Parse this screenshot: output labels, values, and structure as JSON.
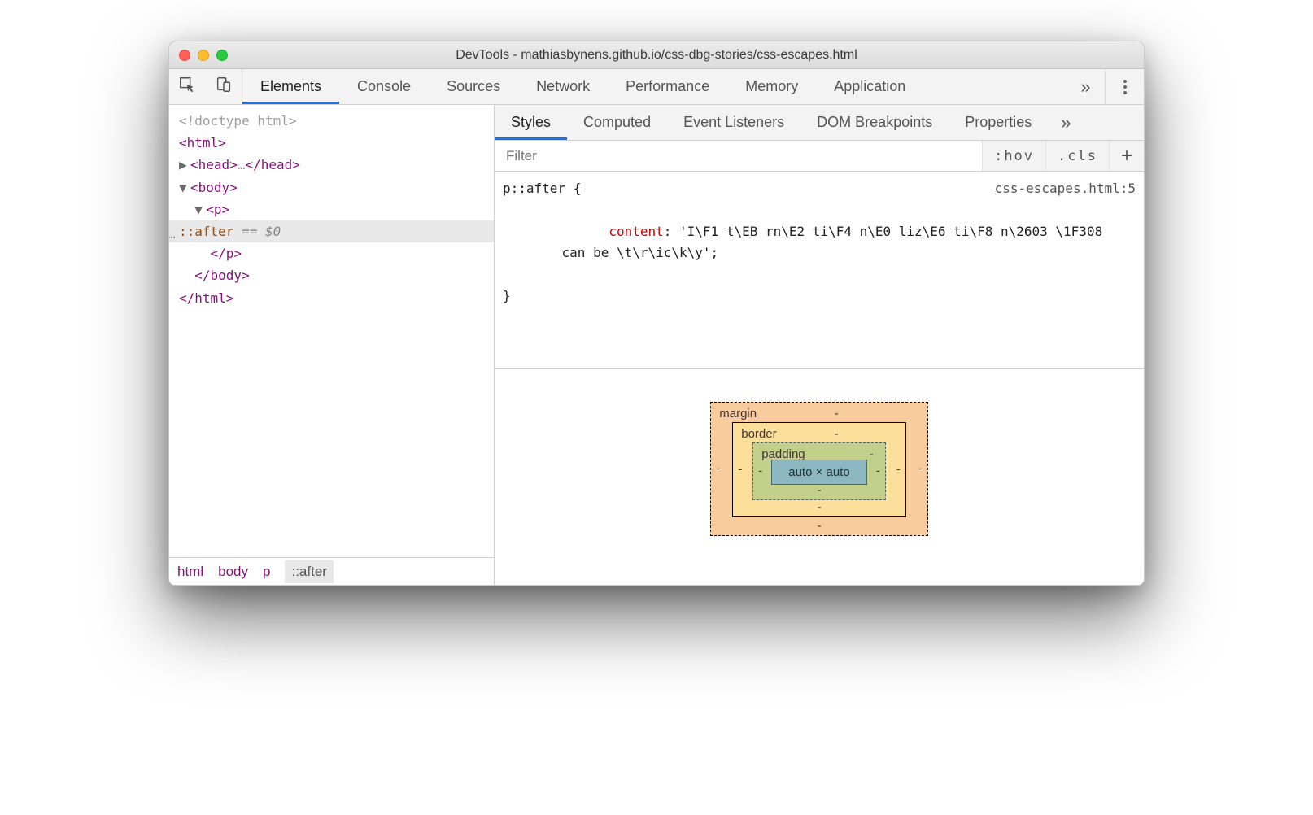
{
  "window": {
    "title": "DevTools - mathiasbynens.github.io/css-dbg-stories/css-escapes.html"
  },
  "toolbar": {
    "tabs": [
      "Elements",
      "Console",
      "Sources",
      "Network",
      "Performance",
      "Memory",
      "Application"
    ],
    "active_index": 0,
    "overflow_glyph": "»"
  },
  "dom": {
    "doctype": "<!doctype html>",
    "html_open": "html",
    "head_open": "head",
    "head_ellipsis": "…",
    "body_open": "body",
    "p_open": "p",
    "selected_pseudo": "::after",
    "selected_suffix": " == $0",
    "p_close": "p",
    "body_close": "body",
    "html_close": "html"
  },
  "breadcrumb": {
    "items": [
      "html",
      "body",
      "p",
      "::after"
    ],
    "active_index": 3
  },
  "styles_tabs": {
    "tabs": [
      "Styles",
      "Computed",
      "Event Listeners",
      "DOM Breakpoints",
      "Properties"
    ],
    "active_index": 0,
    "overflow_glyph": "»"
  },
  "filter": {
    "placeholder": "Filter",
    "hov": ":hov",
    "cls": ".cls",
    "plus": "+"
  },
  "rule": {
    "selector": "p::after {",
    "source": "css-escapes.html:5",
    "prop": "content",
    "colon": ": ",
    "value_line1": "'I\\F1 t\\EB rn\\E2 ti\\F4 n\\E0 liz\\E6 ti\\F8 n\\2603 \\1F308",
    "value_line2": "can be \\t\\r\\ic\\k\\y';",
    "close": "}"
  },
  "boxmodel": {
    "margin_label": "margin",
    "border_label": "border",
    "padding_label": "padding",
    "content": "auto × auto",
    "dash": "-"
  }
}
